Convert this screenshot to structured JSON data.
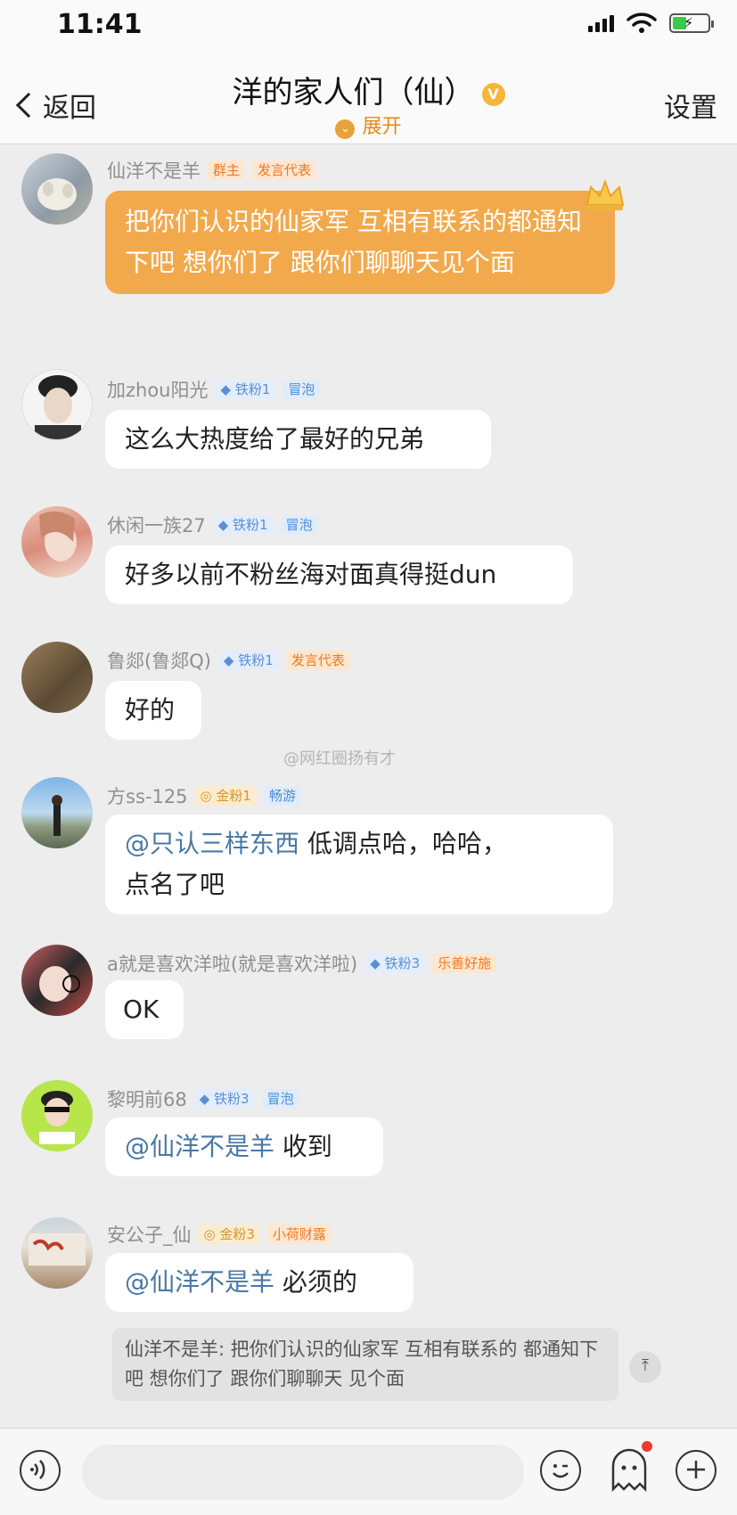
{
  "status_bar": {
    "time": "11:41",
    "battery_pct": 0.4
  },
  "header": {
    "back_label": "返回",
    "title": "洋的家人们（仙）",
    "vip_letter": "V",
    "expand_label": "展开",
    "settings_label": "设置"
  },
  "messages": [
    {
      "name": "仙洋不是羊",
      "badges": [
        "群主",
        "发言代表"
      ],
      "text": "把你们认识的仙家军 互相有联系的都通知下吧 想你们了 跟你们聊聊天见个面"
    },
    {
      "name": "加zhou阳光",
      "badges": [
        "铁粉1",
        "冒泡"
      ],
      "text": "这么大热度给了最好的兄弟"
    },
    {
      "name": "休闲一族27",
      "badges": [
        "铁粉1",
        "冒泡"
      ],
      "text": "好多以前不粉丝海对面真得挺dun"
    },
    {
      "name": "鲁郯(鲁郯Q)",
      "badges": [
        "铁粉1",
        "发言代表"
      ],
      "text": "好的"
    },
    {
      "name": "方ss-125",
      "badges": [
        "金粉1",
        "畅游"
      ],
      "mention": "@只认三样东西",
      "text": " 低调点哈，哈哈，",
      "text2": "点名了吧"
    },
    {
      "name": "a就是喜欢洋啦(就是喜欢洋啦)",
      "badges": [
        "铁粉3",
        "乐善好施"
      ],
      "text": "OK"
    },
    {
      "name": "黎明前68",
      "badges": [
        "铁粉3",
        "冒泡"
      ],
      "mention": "@仙洋不是羊",
      "text": " 收到"
    },
    {
      "name": "安公子_仙",
      "badges": [
        "金粉3",
        "小荷财露"
      ],
      "mention": "@仙洋不是羊",
      "text": " 必须的"
    }
  ],
  "watermark": "@网红圈扬有才",
  "quote": {
    "text": "仙洋不是羊: 把你们认识的仙家军 互相有联系的 都通知下吧 想你们了 跟你们聊聊天 见个面"
  },
  "icons": [
    "voice-icon",
    "emoji-icon",
    "ghost-icon",
    "plus-icon"
  ],
  "colors": {
    "accent_orange": "#f2a94c",
    "mention_blue": "#4a78a4",
    "background": "#ededed"
  }
}
